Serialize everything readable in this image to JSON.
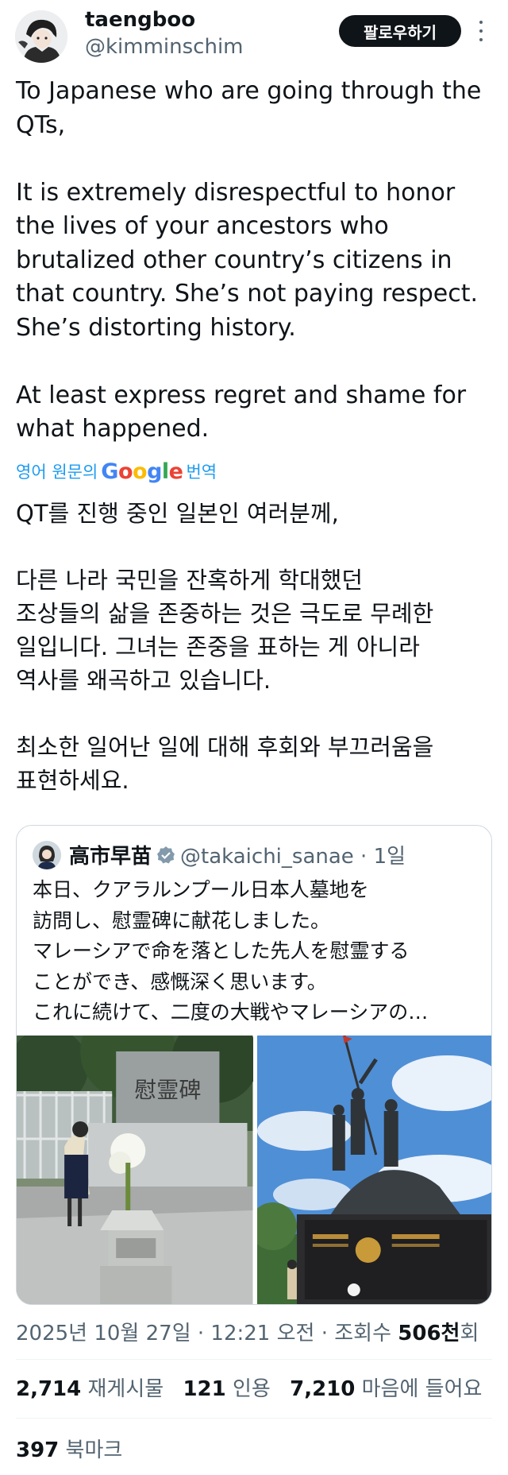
{
  "author": {
    "display_name": "taengboo",
    "handle": "@kimminschim",
    "avatar_icon": "anime-character-avatar"
  },
  "follow_button_label": "팔로우하기",
  "more_icon": "more-vertical-icon",
  "tweet_text": "To Japanese who are going through the QTs,\n\nIt is extremely disrespectful to honor the lives of your ancestors who brutalized other country’s citizens in that country. She’s not paying respect. She’s distorting history.\n\nAt least express regret and shame for what happened.",
  "translation": {
    "prefix": "영어 원문의",
    "google": "Google",
    "suffix": "번역"
  },
  "translated_text": "QT를 진행 중인 일본인 여러분께,\n\n다른 나라 국민을 잔혹하게 학대했던\n조상들의 삶을 존중하는 것은 극도로 무례한\n일입니다. 그녀는 존중을 표하는 게 아니라\n역사를 왜곡하고 있습니다.\n\n최소한 일어난 일에 대해 후회와 부끄러움을\n표현하세요.",
  "quote": {
    "name": "高市早苗",
    "handle_time": "@takaichi_sanae · 1일",
    "verified_icon": "verified-badge-icon",
    "text": "本日、クアラルンプール日本人墓地を\n訪問し、慰霊碑に献花しました。\nマレーシアで命を落とした先人を慰霊する\nことができ、感慨深く思います。\nこれに続けて、二度の大戦やマレーシアの…",
    "images": [
      {
        "name": "memorial-stone-photo",
        "stone_text": "慰霊碑"
      },
      {
        "name": "national-monument-photo"
      }
    ]
  },
  "meta": {
    "date_time": "2025년 10월 27일 · 12:21 오전 · 조회수",
    "views": "506천",
    "views_unit": "회"
  },
  "stats": {
    "retweets": "2,714",
    "retweets_label": "재게시물",
    "quotes": "121",
    "quotes_label": "인용",
    "likes": "7,210",
    "likes_label": "마음에 들어요"
  },
  "bookmarks": {
    "count": "397",
    "label": "북마크"
  },
  "colors": {
    "text": "#0f1419",
    "secondary": "#536471",
    "link": "#1d9bf0",
    "button_bg": "#0f1419",
    "border": "#cfd9de"
  }
}
